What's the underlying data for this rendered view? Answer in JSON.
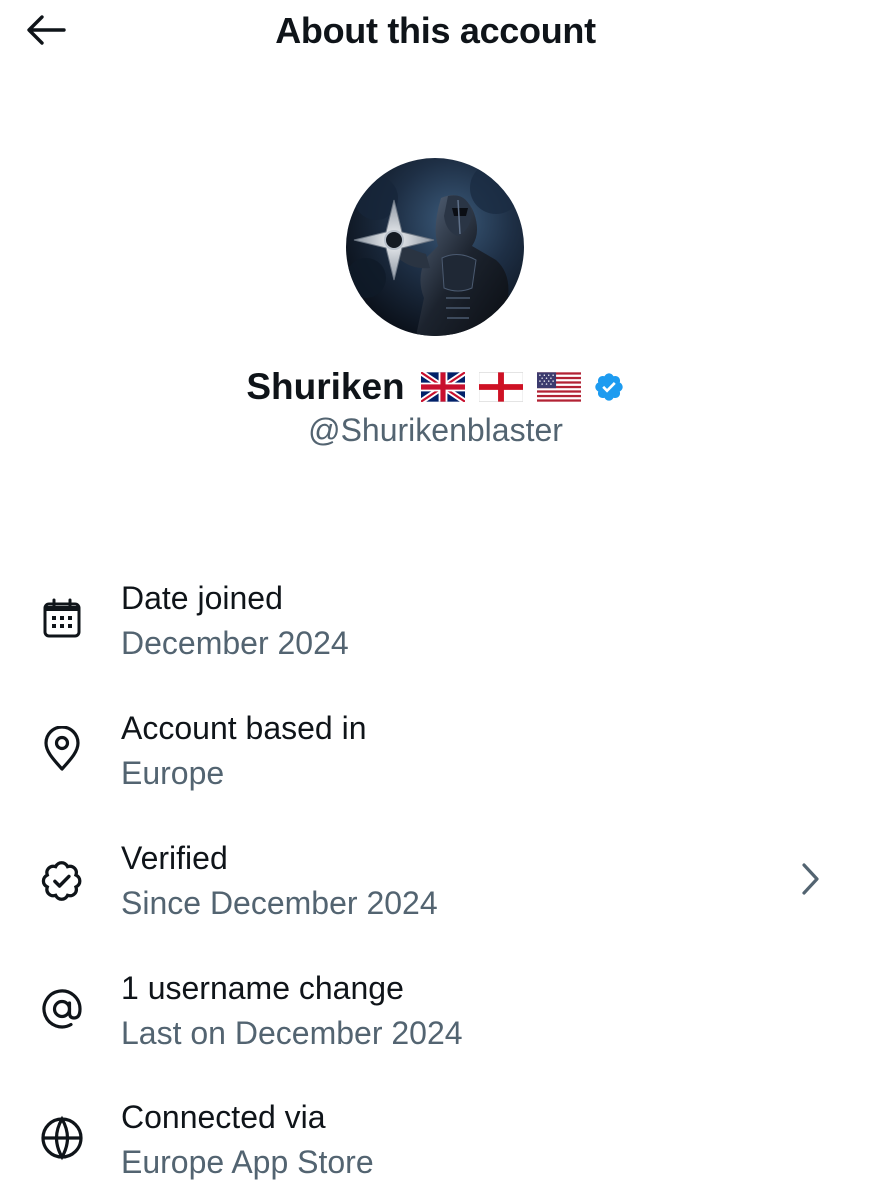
{
  "header": {
    "title": "About this account",
    "back_icon": "arrow-left-icon"
  },
  "profile": {
    "display_name": "Shuriken",
    "flags": [
      "united-kingdom-flag",
      "england-flag",
      "united-states-flag"
    ],
    "verified_badge": "verified-badge-icon",
    "handle": "@Shurikenblaster"
  },
  "info": [
    {
      "icon": "calendar-icon",
      "label": "Date joined",
      "value": "December 2024"
    },
    {
      "icon": "location-pin-icon",
      "label": "Account based in",
      "value": "Europe"
    },
    {
      "icon": "verified-icon",
      "label": "Verified",
      "value": "Since December 2024",
      "has_chevron": true
    },
    {
      "icon": "at-sign-icon",
      "label": "1 username change",
      "value": "Last on December 2024"
    },
    {
      "icon": "globe-icon",
      "label": "Connected via",
      "value": "Europe App Store"
    }
  ],
  "colors": {
    "primary_text": "#0f1419",
    "secondary_text": "#536471",
    "verified_blue": "#1d9bf0",
    "background": "#ffffff"
  }
}
